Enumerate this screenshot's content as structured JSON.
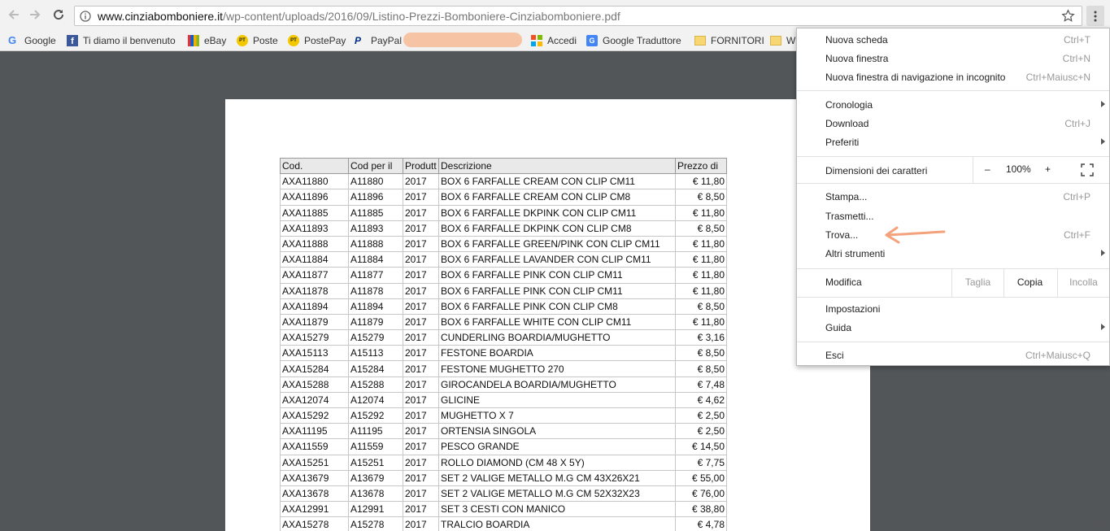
{
  "toolbar": {
    "url_host": "www.cinziabomboniere.it",
    "url_path": "/wp-content/uploads/2016/09/Listino-Prezzi-Bomboniere-Cinziabomboniere.pdf"
  },
  "bookmarks": [
    {
      "label": "Google",
      "icon": "google-icon"
    },
    {
      "label": "Ti diamo il benvenuto",
      "icon": "facebook-icon"
    },
    {
      "label": "eBay",
      "icon": "ebay-icon"
    },
    {
      "label": "Poste",
      "icon": "poste-icon",
      "badge": "PT"
    },
    {
      "label": "PostePay",
      "icon": "postepay-icon",
      "badge": "PT"
    },
    {
      "label": "PayPal",
      "icon": "paypal-icon"
    },
    {
      "label": "Accedi",
      "icon": "microsoft-icon"
    },
    {
      "label": "Google Traduttore",
      "icon": "translate-icon"
    },
    {
      "label": "FORNITORI",
      "icon": "folder-icon"
    },
    {
      "label": "W",
      "icon": "folder-icon"
    }
  ],
  "table": {
    "headers": [
      "Cod.",
      "Cod per il",
      "Produtt",
      "Descrizione",
      "Prezzo di"
    ],
    "rows": [
      [
        "AXA11880",
        "A11880",
        "2017",
        "BOX 6 FARFALLE CREAM CON CLIP CM11",
        "€ 11,80"
      ],
      [
        "AXA11896",
        "A11896",
        "2017",
        "BOX 6 FARFALLE CREAM CON CLIP CM8",
        "€ 8,50"
      ],
      [
        "AXA11885",
        "A11885",
        "2017",
        "BOX 6 FARFALLE DKPINK CON CLIP CM11",
        "€ 11,80"
      ],
      [
        "AXA11893",
        "A11893",
        "2017",
        "BOX 6 FARFALLE DKPINK CON CLIP CM8",
        "€ 8,50"
      ],
      [
        "AXA11888",
        "A11888",
        "2017",
        "BOX 6 FARFALLE GREEN/PINK CON CLIP CM11",
        "€ 11,80"
      ],
      [
        "AXA11884",
        "A11884",
        "2017",
        "BOX 6 FARFALLE LAVANDER CON CLIP CM11",
        "€ 11,80"
      ],
      [
        "AXA11877",
        "A11877",
        "2017",
        "BOX 6 FARFALLE PINK CON CLIP CM11",
        "€ 11,80"
      ],
      [
        "AXA11878",
        "A11878",
        "2017",
        "BOX 6 FARFALLE PINK CON CLIP CM11",
        "€ 11,80"
      ],
      [
        "AXA11894",
        "A11894",
        "2017",
        "BOX 6 FARFALLE PINK CON CLIP CM8",
        "€ 8,50"
      ],
      [
        "AXA11879",
        "A11879",
        "2017",
        "BOX 6 FARFALLE WHITE CON CLIP CM11",
        "€ 11,80"
      ],
      [
        "AXA15279",
        "A15279",
        "2017",
        "CUNDERLING BOARDIA/MUGHETTO",
        "€ 3,16"
      ],
      [
        "AXA15113",
        "A15113",
        "2017",
        "FESTONE BOARDIA",
        "€ 8,50"
      ],
      [
        "AXA15284",
        "A15284",
        "2017",
        "FESTONE MUGHETTO 270",
        "€ 8,50"
      ],
      [
        "AXA15288",
        "A15288",
        "2017",
        "GIROCANDELA BOARDIA/MUGHETTO",
        "€ 7,48"
      ],
      [
        "AXA12074",
        "A12074",
        "2017",
        "GLICINE",
        "€ 4,62"
      ],
      [
        "AXA15292",
        "A15292",
        "2017",
        "MUGHETTO X 7",
        "€ 2,50"
      ],
      [
        "AXA11195",
        "A11195",
        "2017",
        "ORTENSIA SINGOLA",
        "€ 2,50"
      ],
      [
        "AXA11559",
        "A11559",
        "2017",
        "PESCO GRANDE",
        "€ 14,50"
      ],
      [
        "AXA15251",
        "A15251",
        "2017",
        "ROLLO DIAMOND (CM 48 X 5Y)",
        "€ 7,75"
      ],
      [
        "AXA13679",
        "A13679",
        "2017",
        "SET 2 VALIGE METALLO M.G CM 43X26X21",
        "€ 55,00"
      ],
      [
        "AXA13678",
        "A13678",
        "2017",
        "SET 2 VALIGE METALLO M.G CM 52X32X23",
        "€ 76,00"
      ],
      [
        "AXA12991",
        "A12991",
        "2017",
        "SET 3 CESTI CON MANICO",
        "€ 38,80"
      ],
      [
        "AXA15278",
        "A15278",
        "2017",
        "TRALCIO BOARDIA",
        "€ 4,78"
      ]
    ]
  },
  "menu": {
    "nuova_scheda": {
      "label": "Nuova scheda",
      "shortcut": "Ctrl+T"
    },
    "nuova_finestra": {
      "label": "Nuova finestra",
      "shortcut": "Ctrl+N"
    },
    "incognito": {
      "label": "Nuova finestra di navigazione in incognito",
      "shortcut": "Ctrl+Maiusc+N"
    },
    "cronologia": {
      "label": "Cronologia"
    },
    "download": {
      "label": "Download",
      "shortcut": "Ctrl+J"
    },
    "preferiti": {
      "label": "Preferiti"
    },
    "zoom": {
      "label": "Dimensioni dei caratteri",
      "minus": "–",
      "value": "100%",
      "plus": "+"
    },
    "stampa": {
      "label": "Stampa...",
      "shortcut": "Ctrl+P"
    },
    "trasmetti": {
      "label": "Trasmetti..."
    },
    "trova": {
      "label": "Trova...",
      "shortcut": "Ctrl+F"
    },
    "altri_strumenti": {
      "label": "Altri strumenti"
    },
    "modifica": {
      "label": "Modifica",
      "taglia": "Taglia",
      "copia": "Copia",
      "incolla": "Incolla"
    },
    "impostazioni": {
      "label": "Impostazioni"
    },
    "guida": {
      "label": "Guida"
    },
    "esci": {
      "label": "Esci",
      "shortcut": "Ctrl+Maiusc+Q"
    }
  },
  "colors": {
    "annotation": "#f4a27c",
    "page_bg": "#525659"
  }
}
